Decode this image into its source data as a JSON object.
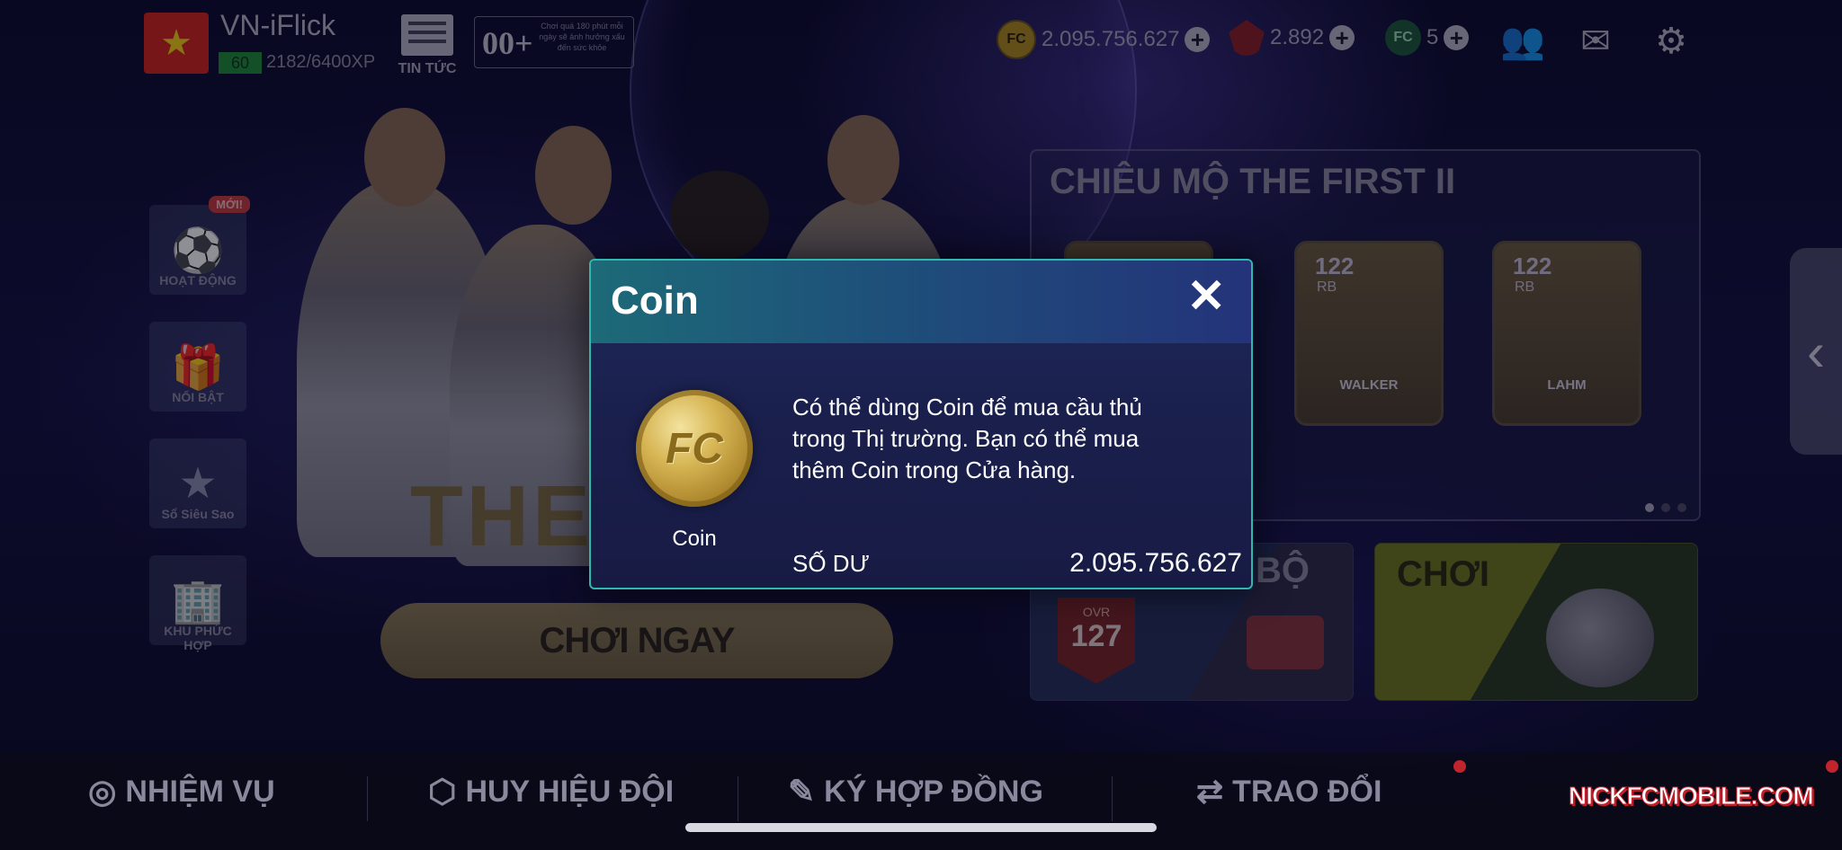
{
  "profile": {
    "username": "VN-iFlick",
    "level": "60",
    "xp": "2182/6400XP",
    "flag_star": "★"
  },
  "header": {
    "news_label": "TIN TỨC",
    "promo_big": "00+",
    "promo_text": "Chơi quá 180 phút mỗi ngày sẽ ảnh hưởng xấu đến sức khỏe",
    "coins": "2.095.756.627",
    "gems": "2.892",
    "tokens": "5",
    "plus": "+"
  },
  "sidebar": {
    "items": [
      {
        "label": "HOẠT ĐỘNG",
        "badge": "MỚI!"
      },
      {
        "label": "NỔI BẬT"
      },
      {
        "label": "Sổ Siêu Sao"
      },
      {
        "label": "KHU PHỨC HỢP"
      }
    ]
  },
  "hero": {
    "text": "THE",
    "play_now": "CHƠI NGAY"
  },
  "recruit": {
    "title": "CHIÊU MỘ THE FIRST II",
    "cards": [
      {
        "ovr": "122",
        "pos": "RB",
        "name": "WALKER"
      },
      {
        "ovr": "122",
        "pos": "RB",
        "name": "LAHM"
      }
    ]
  },
  "panels": {
    "team_fragment": "BỘ",
    "ovr_label": "OVR",
    "ovr_value": "127",
    "play_label": "CHƠI"
  },
  "bottom_nav": [
    {
      "label": "NHIỆM VỤ"
    },
    {
      "label": "HUY HIỆU ĐỘI"
    },
    {
      "label": "KÝ HỢP ĐỒNG"
    },
    {
      "label": "TRAO ĐỔI"
    }
  ],
  "watermark": "NICKFCMOBILE.COM",
  "modal": {
    "title": "Coin",
    "close": "✕",
    "coin_glyph": "FC",
    "coin_caption": "Coin",
    "description": "Có thể dùng Coin để mua cầu thủ trong Thị trường. Bạn có thể mua thêm Coin trong Cửa hàng.",
    "balance_label": "SỐ DƯ",
    "balance_value": "2.095.756.627"
  },
  "colors": {
    "modal_border": "#2fb8b0",
    "coin_gold": "#d7b655",
    "accent_red": "#c0242d"
  }
}
